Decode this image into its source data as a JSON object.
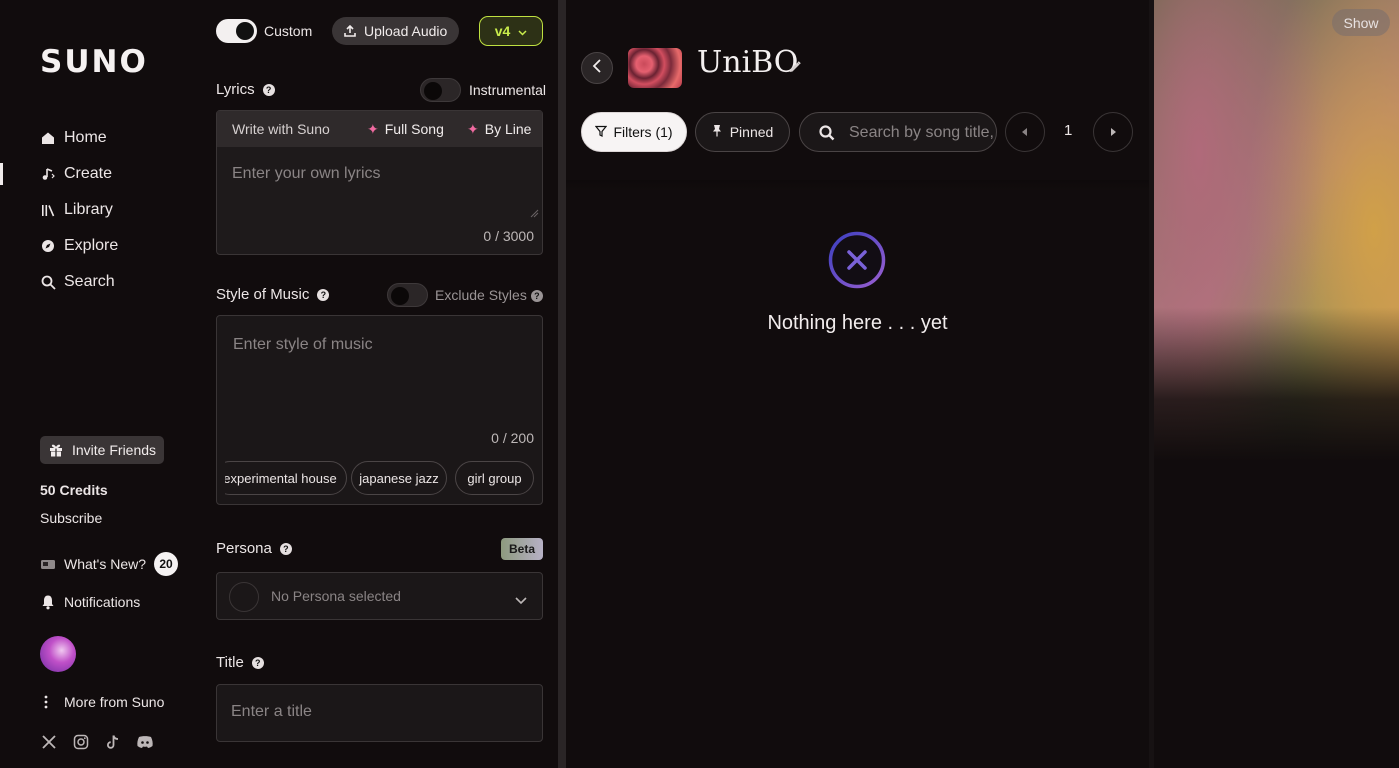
{
  "brand": {
    "logo": "SUNO"
  },
  "nav": {
    "home": "Home",
    "create": "Create",
    "library": "Library",
    "explore": "Explore",
    "search": "Search"
  },
  "sidebar": {
    "invite": "Invite Friends",
    "credits": "50 Credits",
    "subscribe": "Subscribe",
    "whats_new": "What's New?",
    "whats_new_count": "20",
    "notifications": "Notifications",
    "more": "More from Suno"
  },
  "create": {
    "custom_label": "Custom",
    "custom_on": true,
    "upload_label": "Upload Audio",
    "version": "v4",
    "lyrics_label": "Lyrics",
    "instrumental_label": "Instrumental",
    "tabs": {
      "write": "Write with Suno",
      "full_song": "Full Song",
      "by_line": "By Line"
    },
    "lyrics_placeholder": "Enter your own lyrics",
    "lyrics_counter": "0 / 3000",
    "style_label": "Style of Music",
    "exclude_label": "Exclude Styles",
    "style_placeholder": "Enter style of music",
    "style_counter": "0 / 200",
    "chips": [
      "experimental house",
      "japanese jazz",
      "girl group"
    ],
    "persona_label": "Persona",
    "beta": "Beta",
    "persona_value": "No Persona selected",
    "title_label": "Title",
    "title_placeholder": "Enter a title"
  },
  "workspace": {
    "title": "UniBO",
    "filters": "Filters (1)",
    "pinned": "Pinned",
    "search_placeholder": "Search by song title, s",
    "page": "1",
    "empty": "Nothing here . . . yet"
  },
  "right": {
    "show": "Show"
  },
  "colors": {
    "accent_version": "#c9ec4c",
    "sparkle": "#f06aa0",
    "empty_icon": "#6a4fc8"
  }
}
